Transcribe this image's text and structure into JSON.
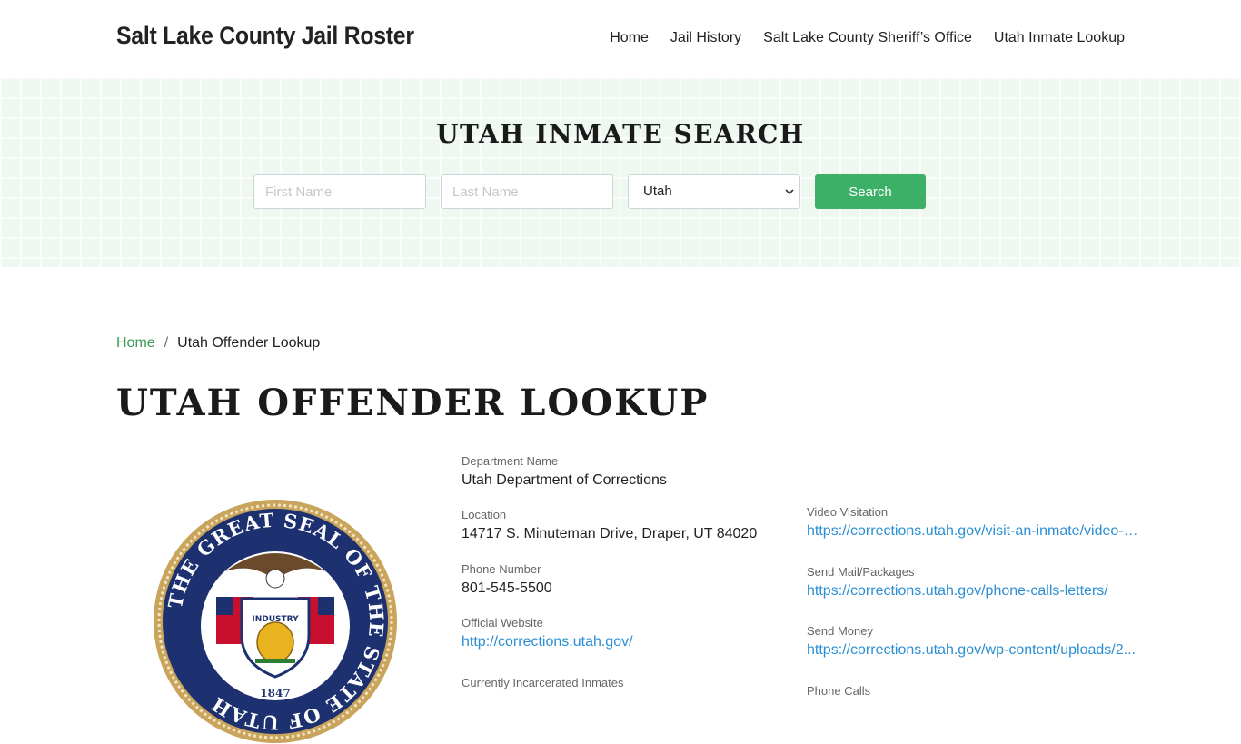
{
  "header": {
    "brand": "Salt Lake County Jail Roster",
    "nav": [
      {
        "label": "Home"
      },
      {
        "label": "Jail History"
      },
      {
        "label": "Salt Lake County Sheriff’s Office"
      },
      {
        "label": "Utah Inmate Lookup"
      }
    ]
  },
  "search": {
    "title": "UTAH INMATE SEARCH",
    "first_name_placeholder": "First Name",
    "last_name_placeholder": "Last Name",
    "state_selected": "Utah",
    "button_label": "Search"
  },
  "breadcrumb": {
    "home": "Home",
    "separator": "/",
    "current": "Utah Offender Lookup"
  },
  "page_title": "UTAH OFFENDER LOOKUP",
  "seal": {
    "ring_text": "THE GREAT SEAL OF THE STATE OF UTAH",
    "motto": "INDUSTRY",
    "year": "1847"
  },
  "details_left": [
    {
      "label": "Department Name",
      "value": "Utah Department of Corrections"
    },
    {
      "label": "Location",
      "value": "14717 S. Minuteman Drive, Draper, UT 84020"
    },
    {
      "label": "Phone Number",
      "value": "801-545-5500"
    },
    {
      "label": "Official Website",
      "value": "http://corrections.utah.gov/"
    },
    {
      "label": "Currently Incarcerated Inmates",
      "value": ""
    }
  ],
  "details_right": [
    {
      "label": "Video Visitation",
      "value": "https://corrections.utah.gov/visit-an-inmate/video-visitation/"
    },
    {
      "label": "Send Mail/Packages",
      "value": "https://corrections.utah.gov/phone-calls-letters/"
    },
    {
      "label": "Send Money",
      "value": "https://corrections.utah.gov/wp-content/uploads/2..."
    },
    {
      "label": "Phone Calls",
      "value": ""
    }
  ],
  "colors": {
    "accent_green": "#3cb066",
    "link_blue": "#2b8fd3",
    "breadcrumb_green": "#3a9a57",
    "seal_navy": "#1d3170",
    "seal_gold": "#c9a45c"
  }
}
